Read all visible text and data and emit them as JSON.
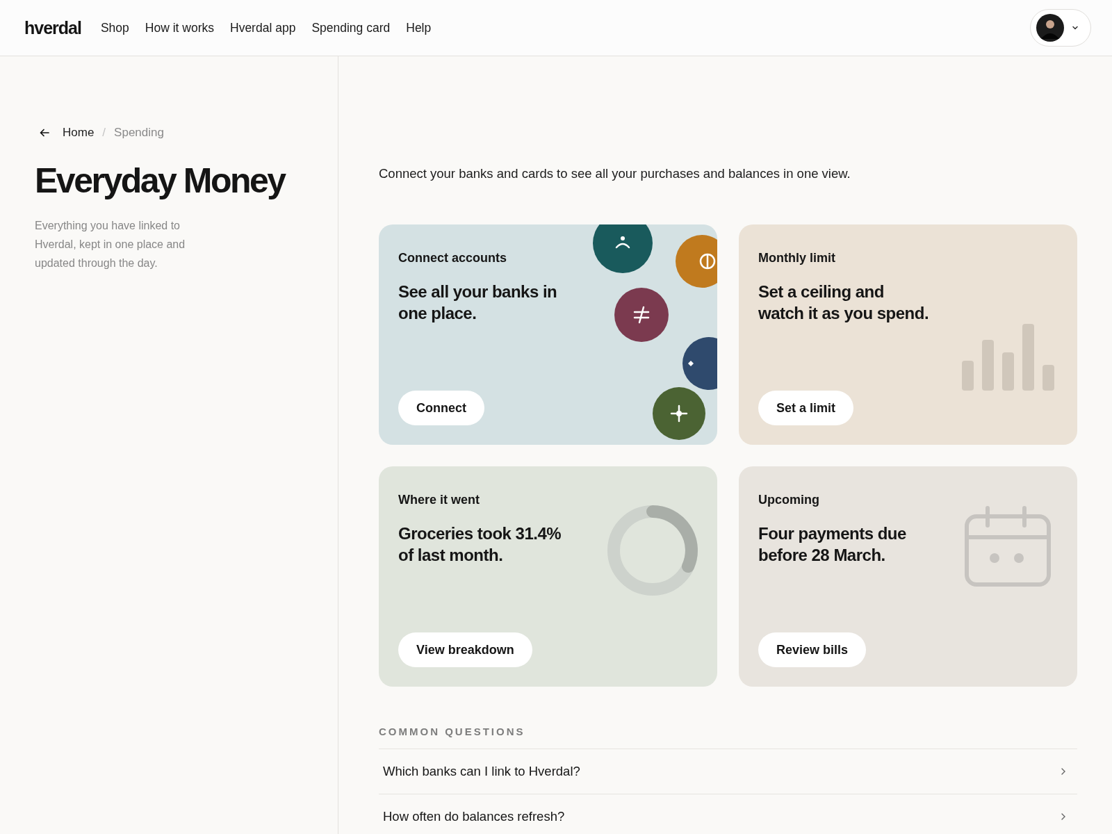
{
  "header": {
    "logo": "hverdal",
    "nav": [
      {
        "label": "Shop"
      },
      {
        "label": "How it works"
      },
      {
        "label": "Hverdal app"
      },
      {
        "label": "Spending card"
      },
      {
        "label": "Help"
      }
    ]
  },
  "breadcrumb": {
    "separator": "/",
    "items": [
      {
        "label": "Home"
      },
      {
        "label": "Spending"
      }
    ]
  },
  "title": "Everyday Money",
  "description": "Everything you have linked to Hverdal, kept in one place and updated through the day.",
  "intro": "Connect your banks and cards to see all your purchases and balances in one view.",
  "cards": [
    {
      "kind": "banks",
      "label": "Connect accounts",
      "heading": "See all your banks in one place.",
      "button": "Connect",
      "color": "#d4e1e3"
    },
    {
      "kind": "bars",
      "label": "Monthly limit",
      "heading": "Set a ceiling and watch it as you spend.",
      "button": "Set a limit",
      "color": "#ebe2d6"
    },
    {
      "kind": "donut",
      "label": "Where it went",
      "heading": "Groceries took 31.4% of last month.",
      "button": "View breakdown",
      "color": "#e0e5dc"
    },
    {
      "kind": "calendar",
      "label": "Upcoming",
      "heading": "Four payments due before 28 March.",
      "button": "Review bills",
      "color": "#e8e4de"
    }
  ],
  "faq": {
    "title": "COMMON QUESTIONS",
    "items": [
      {
        "question": "Which banks can I link to Hverdal?"
      },
      {
        "question": "How often do balances refresh?"
      }
    ]
  }
}
